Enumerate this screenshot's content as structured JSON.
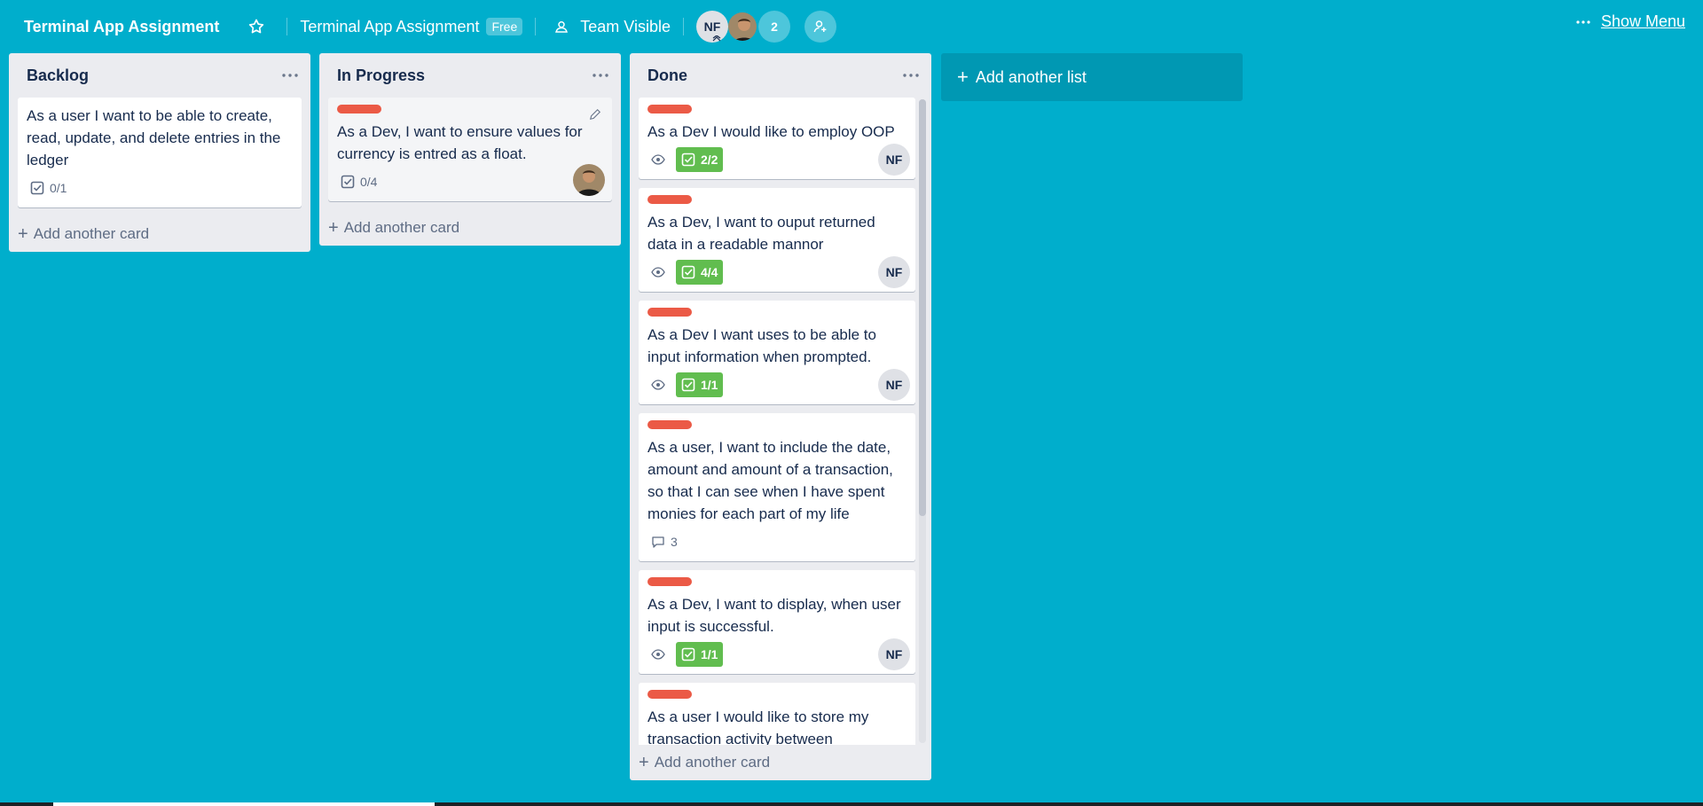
{
  "header": {
    "board_title": "Terminal App Assignment",
    "workspace_name": "Terminal App Assignment",
    "plan_badge": "Free",
    "visibility": "Team Visible",
    "member_initials": "NF",
    "member_count": "2",
    "show_menu": "Show Menu"
  },
  "lists": [
    {
      "title": "Backlog",
      "add_card": "Add another card",
      "cards": [
        {
          "title": "As a user I want to be able to create, read, update, and delete entries in the ledger",
          "checklist": "0/1"
        }
      ]
    },
    {
      "title": "In Progress",
      "add_card": "Add another card",
      "cards": [
        {
          "title": "As a Dev, I want to ensure values for currency is entred as a float.",
          "checklist": "0/4"
        }
      ]
    },
    {
      "title": "Done",
      "add_card": "Add another card",
      "cards": [
        {
          "title": "As a Dev I would like to employ OOP",
          "checklist": "2/2",
          "member": "NF"
        },
        {
          "title": "As a Dev, I want to ouput returned data in a readable mannor",
          "checklist": "4/4",
          "member": "NF"
        },
        {
          "title": "As a Dev I want uses to be able to input information when prompted.",
          "checklist": "1/1",
          "member": "NF"
        },
        {
          "title": "As a user, I want to include the date, amount and amount of a transaction, so that I can see when I have spent monies for each part of my life",
          "comments": "3"
        },
        {
          "title": "As a Dev, I want to display, when user input is successful.",
          "checklist": "1/1",
          "member": "NF"
        },
        {
          "title": "As a user I would like to store my transaction activity between"
        }
      ]
    }
  ],
  "add_list": "Add another list",
  "colors": {
    "board_bg": "#00aecc",
    "label_red": "#eb5a46",
    "badge_green": "#61bd4f",
    "list_bg": "#ebecf0"
  }
}
